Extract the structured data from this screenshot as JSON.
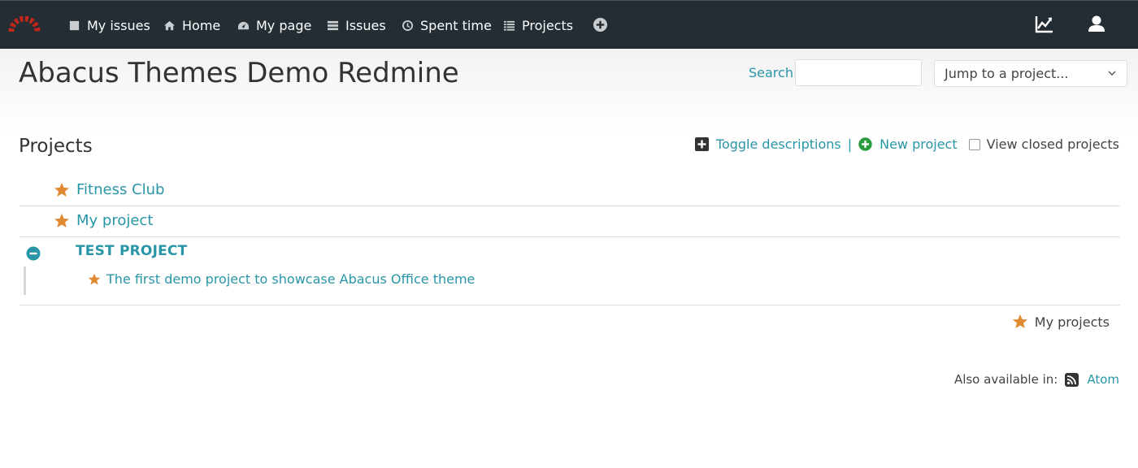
{
  "nav": {
    "items": [
      {
        "label": "My issues",
        "icon": "square-icon"
      },
      {
        "label": "Home",
        "icon": "home-icon"
      },
      {
        "label": "My page",
        "icon": "dashboard-icon"
      },
      {
        "label": "Issues",
        "icon": "list-icon"
      },
      {
        "label": "Spent time",
        "icon": "clock-icon"
      },
      {
        "label": "Projects",
        "icon": "list-lines-icon"
      }
    ],
    "plus_icon": "plus-circle-icon",
    "right_icons": [
      "activity-chart-icon",
      "user-icon"
    ]
  },
  "header": {
    "title": "Abacus Themes Demo Redmine",
    "search_label": "Search",
    "search_colon": ":",
    "search_value": "",
    "jump_label": "Jump to a project..."
  },
  "projects": {
    "title": "Projects",
    "toggle_descriptions": "Toggle descriptions",
    "separator": "|",
    "new_project": "New project",
    "view_closed": "View closed projects",
    "list": [
      {
        "name": "Fitness Club",
        "starred": true
      },
      {
        "name": "My project",
        "starred": true
      },
      {
        "name": "TEST PROJECT",
        "starred": false,
        "children": [
          {
            "name": "The first demo project to showcase Abacus Office theme",
            "starred": true
          }
        ]
      }
    ],
    "legend": "My projects"
  },
  "footer": {
    "also_available": "Also available in:",
    "atom": "Atom"
  },
  "colors": {
    "topbar": "#232d33",
    "link": "#2996a7",
    "star": "#e08b32",
    "new_project_green": "#2a9a3f"
  }
}
